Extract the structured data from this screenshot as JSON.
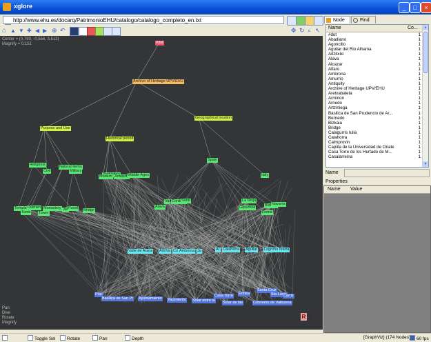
{
  "window": {
    "title": "xglore"
  },
  "address": {
    "url": "http://www.ehu.es/docarq/PatrimonioEHU/catalogo/catalogo_completo_en.txt"
  },
  "canvas": {
    "info": [
      "Center = (0,790, -0,556, 3,513)",
      "Magnify = 0,151"
    ],
    "modes": [
      "Pan",
      "Dive",
      "Rotate",
      "Magnify"
    ],
    "logo": "R"
  },
  "graph": {
    "root": "#dot",
    "archive": "Archive of Heritage UPV/EHU",
    "categories": [
      "Purpose and Use",
      "Historical period",
      "Geographical location"
    ],
    "subs": [
      "Religious",
      "Civil",
      "Natural Items",
      "Military",
      "Prehistory",
      "Antiquity",
      "Middle Ages",
      "Modern",
      "Spain",
      "Italy"
    ],
    "types": [
      "Temple",
      "Dolmen",
      "Monastery",
      "Jar",
      "Fossil",
      "Tomb",
      "Tower",
      "Bridge"
    ],
    "regions": [
      "Alava",
      "Va",
      "Cordoba",
      "Soria",
      "La Rioja",
      "Bizkaia",
      "Navarra",
      "Gipuzkoa",
      "Roma"
    ],
    "places": [
      "Valle de Arana",
      "Ala",
      "EVa",
      "Co",
      "Ambrona",
      "Ja",
      "Ar",
      "Calahorra",
      "Aguilar",
      "Logrono",
      "Ibarra"
    ],
    "items": [
      "Plac",
      "Basilica de San Pr",
      "Ayuntamiento",
      "Yacimiento",
      "Solar entre la",
      "Solar de las",
      "Convento de Valbuena",
      "Casa Torre",
      "Ermita",
      "Santa Cruz",
      "Sta Lucia",
      "Carriz"
    ]
  },
  "panel": {
    "tabs": [
      "Node",
      "Find"
    ],
    "columns": [
      "Name",
      "Co..."
    ],
    "rows": [
      [
        "#dot",
        "1"
      ],
      [
        "Abadiano",
        "1"
      ],
      [
        "Agoncillo",
        "1"
      ],
      [
        "Aguilar del Rio Alhama",
        "1"
      ],
      [
        "Aitzitxiki",
        "1"
      ],
      [
        "Alava",
        "1"
      ],
      [
        "Alcazar",
        "1"
      ],
      [
        "Alfaro",
        "1"
      ],
      [
        "Ambrona",
        "1"
      ],
      [
        "Amurrio",
        "1"
      ],
      [
        "Antiquity",
        "1"
      ],
      [
        "Archive of Heritage UPV/EHU",
        "1"
      ],
      [
        "Aretxabaleta",
        "1"
      ],
      [
        "Arminon",
        "1"
      ],
      [
        "Arnedo",
        "1"
      ],
      [
        "Artziniega",
        "1"
      ],
      [
        "Basilica de San Prudencio de Ar...",
        "1"
      ],
      [
        "Bernedo",
        "1"
      ],
      [
        "Bizkaia",
        "1"
      ],
      [
        "Bridge",
        "1"
      ],
      [
        "Calagurris Iulia",
        "1"
      ],
      [
        "Calahorra",
        "1"
      ],
      [
        "Calmprovin",
        "1"
      ],
      [
        "Capilla de la Universidad de Onate",
        "1"
      ],
      [
        "Casa Torre de los Hurtado de M...",
        "1"
      ],
      [
        "Casalarreina",
        "1"
      ]
    ],
    "name_label": "Name",
    "properties_label": "Properties",
    "prop_columns": [
      "Name",
      "Value"
    ]
  },
  "status": {
    "toggle_sel": "Toggle Sel",
    "rotate": "Rotate",
    "pan": "Pan",
    "depth": "Depth",
    "graph_info": "[GraphViz] (174 Nodes)",
    "fps": "60 fps"
  },
  "colors": {
    "canvas_bg": "#333536",
    "root": "#e8556c",
    "archive": "#f3bb66",
    "category": "#d2f046",
    "sub": "#5ae874",
    "place": "#6ae8f2",
    "item": "#5577dd",
    "edge": "#c8c8c8"
  }
}
